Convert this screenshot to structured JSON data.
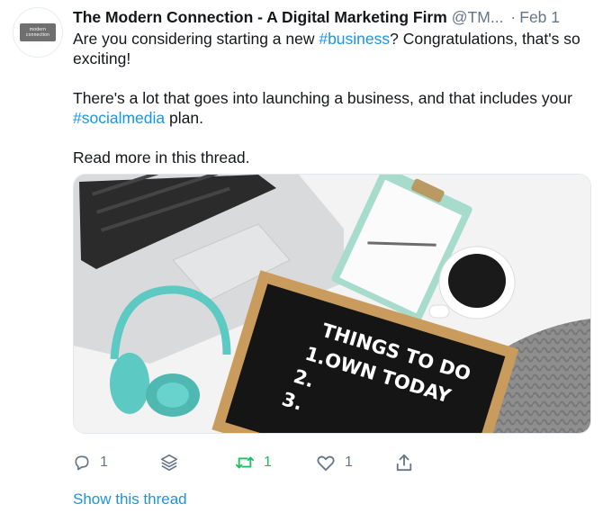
{
  "tweet": {
    "author_name": "The Modern Connection - A Digital Marketing Firm",
    "author_handle": "@TM...",
    "separator": "·",
    "date": "Feb 1",
    "paragraphs": [
      {
        "pre": "Are you considering starting a new ",
        "hashtag": "#business",
        "post": "? Congratulations, that's so exciting!"
      },
      {
        "pre": "There's a lot that goes into launching a business, and that includes your ",
        "hashtag": "#socialmedia",
        "post": " plan."
      },
      {
        "text": "Read more in this thread."
      }
    ],
    "avatar_logo": {
      "line1": "connection",
      "line2": "modern"
    },
    "image": {
      "board_lines": [
        "THINGS TO DO",
        "1.OWN TODAY",
        "2.",
        "3."
      ]
    }
  },
  "actions": {
    "reply": {
      "icon": "reply-icon",
      "count": "1"
    },
    "stack": {
      "icon": "layers-icon"
    },
    "retweet": {
      "icon": "retweet-icon",
      "count": "1",
      "color": "#17bf63"
    },
    "like": {
      "icon": "heart-icon",
      "count": "1"
    },
    "share": {
      "icon": "share-icon"
    }
  },
  "show_thread": "Show this thread",
  "colors": {
    "link": "#1b95e0",
    "muted": "#657786",
    "text": "#14171a"
  }
}
